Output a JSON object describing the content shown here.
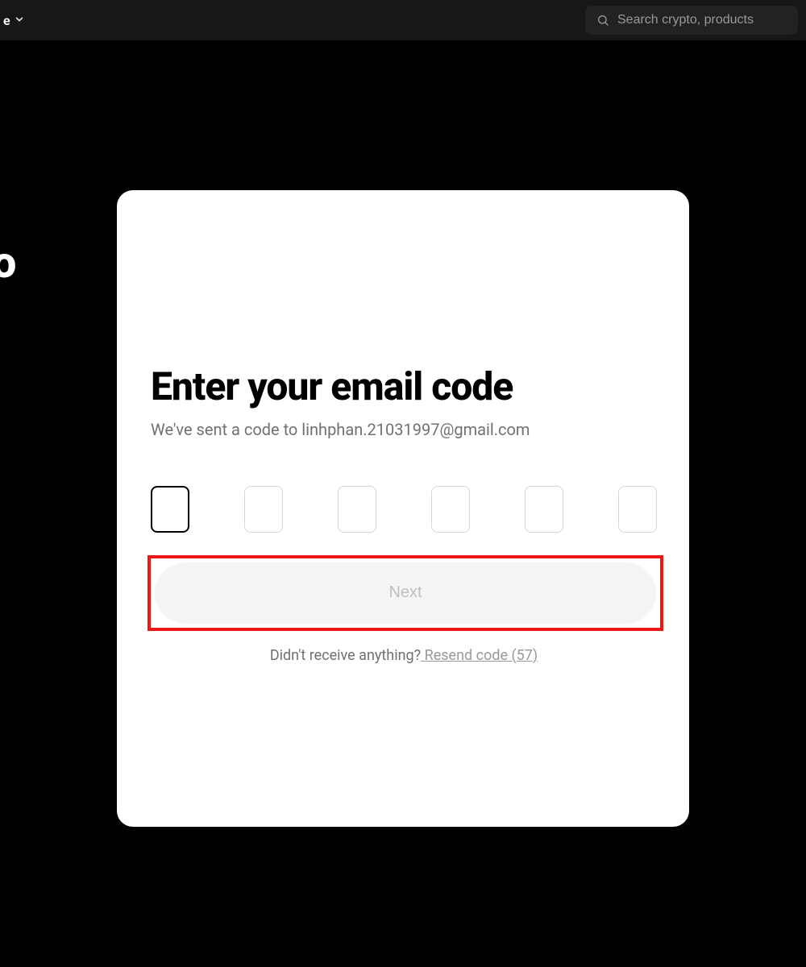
{
  "topbar": {
    "nav_fragment": "e",
    "search_placeholder": "Search crypto, products"
  },
  "background": {
    "partial_text": "o"
  },
  "modal": {
    "title": "Enter your email code",
    "subtitle": "We've sent a code to linhphan.21031997@gmail.com",
    "next_button": "Next",
    "didnt_receive": "Didn't receive anything?",
    "resend_text": " Resend code (57)"
  }
}
